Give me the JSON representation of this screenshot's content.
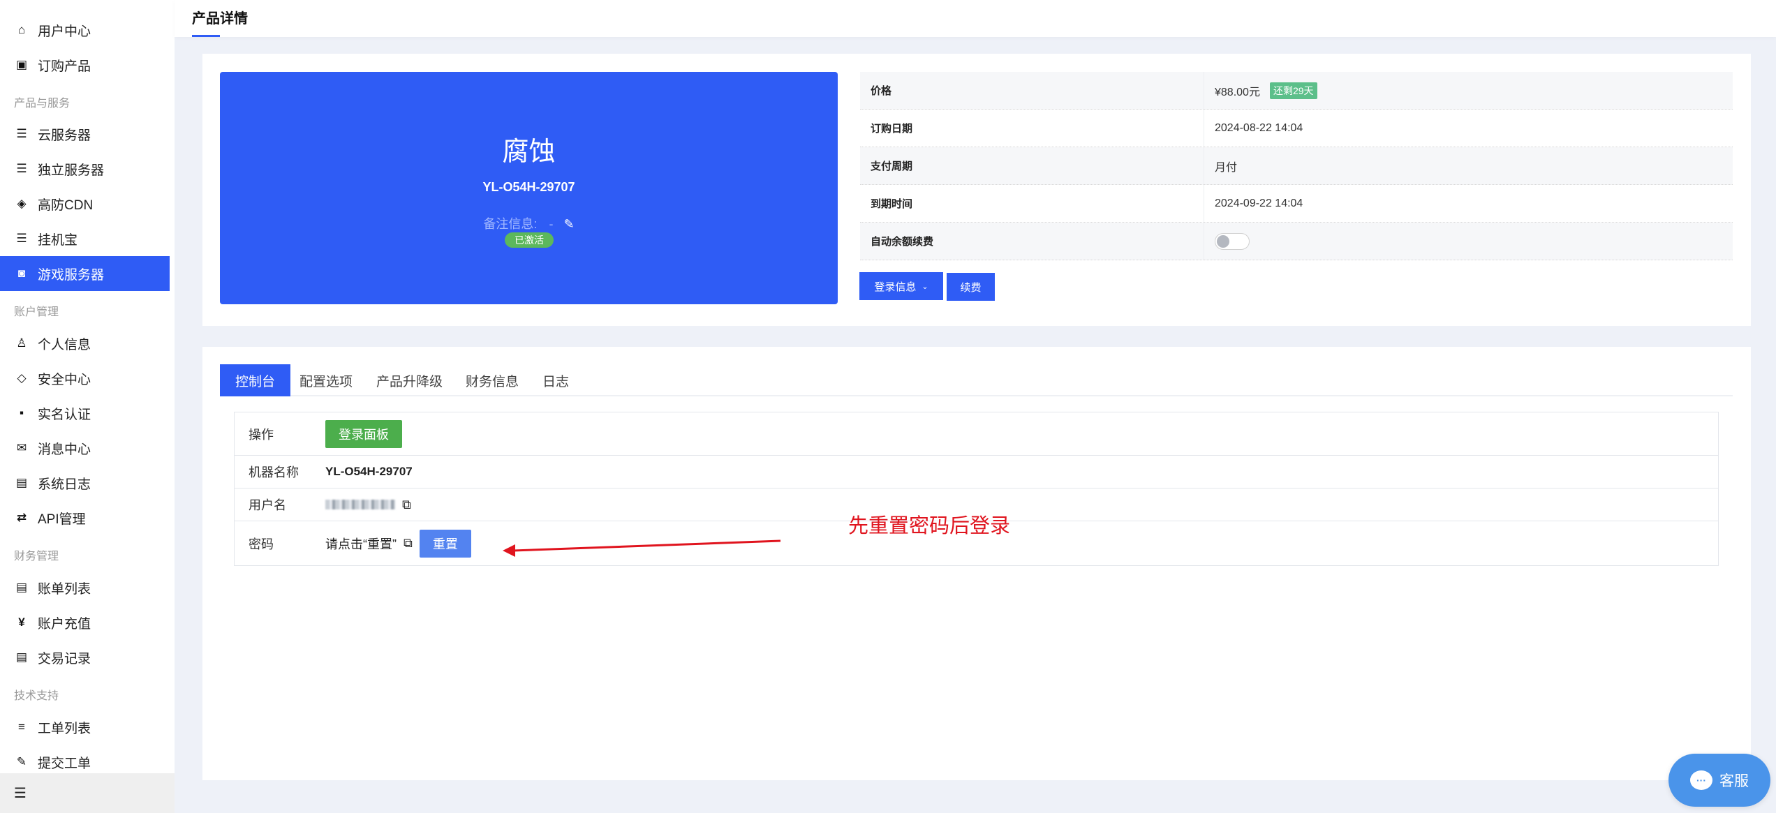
{
  "sidebar": {
    "items": [
      {
        "label": "用户中心",
        "icon": "home-icon",
        "glyph": "⌂"
      },
      {
        "label": "订购产品",
        "icon": "store-icon",
        "glyph": "▣"
      },
      {
        "label": "云服务器",
        "icon": "server-icon",
        "glyph": "☰"
      },
      {
        "label": "独立服务器",
        "icon": "server-icon",
        "glyph": "☰"
      },
      {
        "label": "高防CDN",
        "icon": "shield-check-icon",
        "glyph": "◈"
      },
      {
        "label": "挂机宝",
        "icon": "server-icon",
        "glyph": "☰"
      },
      {
        "label": "游戏服务器",
        "icon": "ghost-icon",
        "glyph": "◙"
      },
      {
        "label": "个人信息",
        "icon": "user-icon",
        "glyph": "♙"
      },
      {
        "label": "安全中心",
        "icon": "shield-icon",
        "glyph": "◇"
      },
      {
        "label": "实名认证",
        "icon": "id-card-icon",
        "glyph": "▪"
      },
      {
        "label": "消息中心",
        "icon": "mail-icon",
        "glyph": "✉"
      },
      {
        "label": "系统日志",
        "icon": "log-icon",
        "glyph": "▤"
      },
      {
        "label": "API管理",
        "icon": "swap-icon",
        "glyph": "⇄"
      },
      {
        "label": "账单列表",
        "icon": "bill-icon",
        "glyph": "▤"
      },
      {
        "label": "账户充值",
        "icon": "yen-icon",
        "glyph": "¥"
      },
      {
        "label": "交易记录",
        "icon": "bill-icon",
        "glyph": "▤"
      },
      {
        "label": "工单列表",
        "icon": "list-icon",
        "glyph": "≡"
      },
      {
        "label": "提交工单",
        "icon": "pen-icon",
        "glyph": "✎"
      }
    ],
    "groups": [
      "产品与服务",
      "账户管理",
      "财务管理",
      "技术支持"
    ],
    "active": "游戏服务器",
    "collapse_glyph": "☰"
  },
  "header": {
    "title": "产品详情"
  },
  "product": {
    "name": "腐蚀",
    "code": "YL-O54H-29707",
    "note_label": "备注信息:",
    "note_value": "-",
    "edit_glyph": "✎",
    "status": "已激活"
  },
  "info": {
    "rows": [
      {
        "label": "价格",
        "value": "¥88.00元",
        "tag": "还剩29天"
      },
      {
        "label": "订购日期",
        "value": "2024-08-22 14:04"
      },
      {
        "label": "支付周期",
        "value": "月付"
      },
      {
        "label": "到期时间",
        "value": "2024-09-22 14:04"
      },
      {
        "label": "自动余额续费",
        "toggle": false
      }
    ],
    "login_info_label": "登录信息",
    "renew_label": "续费"
  },
  "tabs": [
    {
      "label": "控制台",
      "active": true
    },
    {
      "label": "配置选项"
    },
    {
      "label": "产品升降级"
    },
    {
      "label": "财务信息"
    },
    {
      "label": "日志"
    }
  ],
  "console": {
    "operation_label": "操作",
    "login_panel_label": "登录面板",
    "machine_label": "机器名称",
    "machine_value": "YL-O54H-29707",
    "username_label": "用户名",
    "password_label": "密码",
    "password_value": "请点击“重置”",
    "reset_label": "重置"
  },
  "annotation": {
    "text": "先重置密码后登录",
    "color": "#e0141e"
  },
  "chat": {
    "label": "客服",
    "glyph": "···"
  },
  "colors": {
    "primary": "#2f5cf5",
    "success": "#5cb85c",
    "green_button": "#4cae4c"
  }
}
